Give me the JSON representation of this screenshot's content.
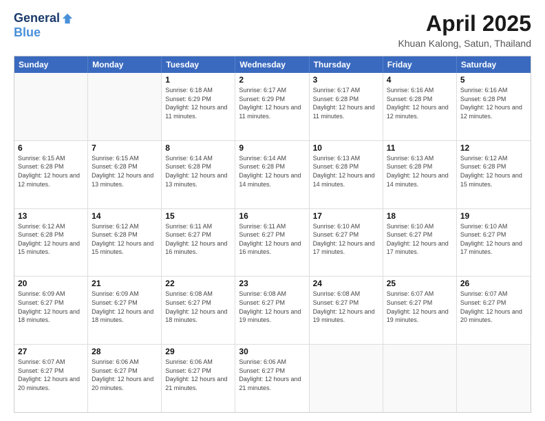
{
  "logo": {
    "general": "General",
    "blue": "Blue"
  },
  "title": "April 2025",
  "subtitle": "Khuan Kalong, Satun, Thailand",
  "days": [
    "Sunday",
    "Monday",
    "Tuesday",
    "Wednesday",
    "Thursday",
    "Friday",
    "Saturday"
  ],
  "weeks": [
    [
      {
        "day": "",
        "info": ""
      },
      {
        "day": "",
        "info": ""
      },
      {
        "day": "1",
        "info": "Sunrise: 6:18 AM\nSunset: 6:29 PM\nDaylight: 12 hours and 11 minutes."
      },
      {
        "day": "2",
        "info": "Sunrise: 6:17 AM\nSunset: 6:29 PM\nDaylight: 12 hours and 11 minutes."
      },
      {
        "day": "3",
        "info": "Sunrise: 6:17 AM\nSunset: 6:28 PM\nDaylight: 12 hours and 11 minutes."
      },
      {
        "day": "4",
        "info": "Sunrise: 6:16 AM\nSunset: 6:28 PM\nDaylight: 12 hours and 12 minutes."
      },
      {
        "day": "5",
        "info": "Sunrise: 6:16 AM\nSunset: 6:28 PM\nDaylight: 12 hours and 12 minutes."
      }
    ],
    [
      {
        "day": "6",
        "info": "Sunrise: 6:15 AM\nSunset: 6:28 PM\nDaylight: 12 hours and 12 minutes."
      },
      {
        "day": "7",
        "info": "Sunrise: 6:15 AM\nSunset: 6:28 PM\nDaylight: 12 hours and 13 minutes."
      },
      {
        "day": "8",
        "info": "Sunrise: 6:14 AM\nSunset: 6:28 PM\nDaylight: 12 hours and 13 minutes."
      },
      {
        "day": "9",
        "info": "Sunrise: 6:14 AM\nSunset: 6:28 PM\nDaylight: 12 hours and 14 minutes."
      },
      {
        "day": "10",
        "info": "Sunrise: 6:13 AM\nSunset: 6:28 PM\nDaylight: 12 hours and 14 minutes."
      },
      {
        "day": "11",
        "info": "Sunrise: 6:13 AM\nSunset: 6:28 PM\nDaylight: 12 hours and 14 minutes."
      },
      {
        "day": "12",
        "info": "Sunrise: 6:12 AM\nSunset: 6:28 PM\nDaylight: 12 hours and 15 minutes."
      }
    ],
    [
      {
        "day": "13",
        "info": "Sunrise: 6:12 AM\nSunset: 6:28 PM\nDaylight: 12 hours and 15 minutes."
      },
      {
        "day": "14",
        "info": "Sunrise: 6:12 AM\nSunset: 6:28 PM\nDaylight: 12 hours and 15 minutes."
      },
      {
        "day": "15",
        "info": "Sunrise: 6:11 AM\nSunset: 6:27 PM\nDaylight: 12 hours and 16 minutes."
      },
      {
        "day": "16",
        "info": "Sunrise: 6:11 AM\nSunset: 6:27 PM\nDaylight: 12 hours and 16 minutes."
      },
      {
        "day": "17",
        "info": "Sunrise: 6:10 AM\nSunset: 6:27 PM\nDaylight: 12 hours and 17 minutes."
      },
      {
        "day": "18",
        "info": "Sunrise: 6:10 AM\nSunset: 6:27 PM\nDaylight: 12 hours and 17 minutes."
      },
      {
        "day": "19",
        "info": "Sunrise: 6:10 AM\nSunset: 6:27 PM\nDaylight: 12 hours and 17 minutes."
      }
    ],
    [
      {
        "day": "20",
        "info": "Sunrise: 6:09 AM\nSunset: 6:27 PM\nDaylight: 12 hours and 18 minutes."
      },
      {
        "day": "21",
        "info": "Sunrise: 6:09 AM\nSunset: 6:27 PM\nDaylight: 12 hours and 18 minutes."
      },
      {
        "day": "22",
        "info": "Sunrise: 6:08 AM\nSunset: 6:27 PM\nDaylight: 12 hours and 18 minutes."
      },
      {
        "day": "23",
        "info": "Sunrise: 6:08 AM\nSunset: 6:27 PM\nDaylight: 12 hours and 19 minutes."
      },
      {
        "day": "24",
        "info": "Sunrise: 6:08 AM\nSunset: 6:27 PM\nDaylight: 12 hours and 19 minutes."
      },
      {
        "day": "25",
        "info": "Sunrise: 6:07 AM\nSunset: 6:27 PM\nDaylight: 12 hours and 19 minutes."
      },
      {
        "day": "26",
        "info": "Sunrise: 6:07 AM\nSunset: 6:27 PM\nDaylight: 12 hours and 20 minutes."
      }
    ],
    [
      {
        "day": "27",
        "info": "Sunrise: 6:07 AM\nSunset: 6:27 PM\nDaylight: 12 hours and 20 minutes."
      },
      {
        "day": "28",
        "info": "Sunrise: 6:06 AM\nSunset: 6:27 PM\nDaylight: 12 hours and 20 minutes."
      },
      {
        "day": "29",
        "info": "Sunrise: 6:06 AM\nSunset: 6:27 PM\nDaylight: 12 hours and 21 minutes."
      },
      {
        "day": "30",
        "info": "Sunrise: 6:06 AM\nSunset: 6:27 PM\nDaylight: 12 hours and 21 minutes."
      },
      {
        "day": "",
        "info": ""
      },
      {
        "day": "",
        "info": ""
      },
      {
        "day": "",
        "info": ""
      }
    ]
  ]
}
